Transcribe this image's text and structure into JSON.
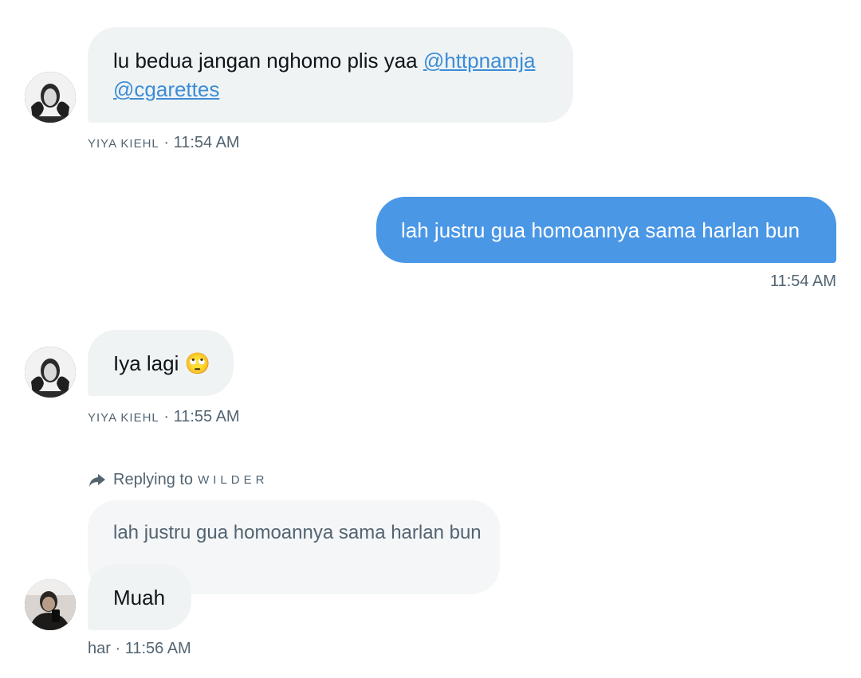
{
  "messages": [
    {
      "sender": "YIYA KIEHL",
      "text": "lu bedua jangan nghomo plis yaa",
      "mention1": "@httpnamja",
      "mention2": "@cgarettes",
      "time": "11:54 AM",
      "separator": "·"
    },
    {
      "text": "lah justru gua homoannya sama harlan bun",
      "time": "11:54 AM"
    },
    {
      "sender": "YIYA KIEHL",
      "text": "Iya lagi",
      "emoji": "🙄",
      "time": "11:55 AM",
      "separator": "·"
    },
    {
      "reply_label": "Replying to",
      "reply_to": "WILDER",
      "quoted_text": "lah justru gua homoannya sama harlan bun",
      "text": "Muah",
      "sender": "har",
      "time": "11:56 AM",
      "separator": "·"
    }
  ],
  "colors": {
    "outgoing_bubble": "#4a97e6",
    "incoming_bubble": "#eff3f4",
    "mention": "#3c8cd6",
    "meta_text": "#536471"
  },
  "icons": {
    "reply": "reply-arrow-icon"
  }
}
